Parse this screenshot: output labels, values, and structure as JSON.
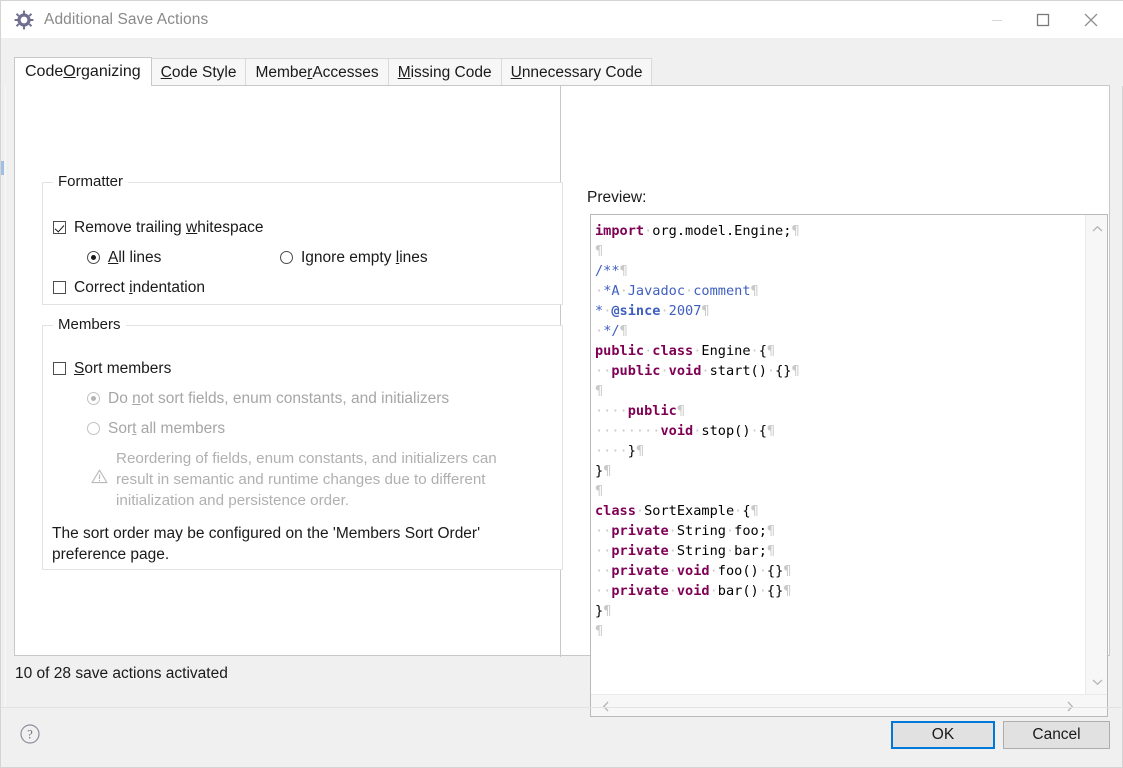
{
  "window": {
    "title": "Additional Save Actions",
    "icon": "gear-icon",
    "minimize_label": "Minimize",
    "maximize_label": "Maximize",
    "close_label": "Close"
  },
  "tabs": [
    {
      "label": "Code Organizing",
      "mnemonic": "O",
      "active": true
    },
    {
      "label": "Code Style",
      "mnemonic": "C",
      "active": false
    },
    {
      "label": "Member Accesses",
      "mnemonic": "r",
      "active": false
    },
    {
      "label": "Missing Code",
      "mnemonic": "M",
      "active": false
    },
    {
      "label": "Unnecessary Code",
      "mnemonic": "U",
      "active": false
    }
  ],
  "formatter": {
    "legend": "Formatter",
    "remove_trailing_whitespace": {
      "label_pre": "Remove trailing ",
      "label_mnemonic": "w",
      "label_post": "hitespace",
      "checked": true
    },
    "all_lines": {
      "label_pre": "",
      "label_mnemonic": "A",
      "label_post": "ll lines",
      "selected": true
    },
    "ignore_empty_lines": {
      "label_pre": "Ignore empty ",
      "label_mnemonic": "l",
      "label_post": "ines",
      "selected": false
    },
    "correct_indentation": {
      "label_pre": "Correct ",
      "label_mnemonic": "i",
      "label_post": "ndentation",
      "checked": false
    }
  },
  "members": {
    "legend": "Members",
    "sort_members": {
      "label_pre": "",
      "label_mnemonic": "S",
      "label_post": "ort members",
      "checked": false
    },
    "do_not_sort": {
      "label_pre": "Do ",
      "label_mnemonic": "n",
      "label_post": "ot sort fields, enum constants, and initializers",
      "selected": true,
      "disabled": true
    },
    "sort_all": {
      "label_pre": "Sor",
      "label_mnemonic": "t",
      "label_post": " all members",
      "selected": false,
      "disabled": true
    },
    "warning_icon": "warning-triangle-icon",
    "warning_text": "Reordering of fields, enum constants, and initializers can\nresult in semantic and runtime changes due to different\ninitialization and persistence order.",
    "sort_order_note": "The sort order may be configured on the 'Members Sort Order' preference page."
  },
  "preview": {
    "label": "Preview:",
    "scroll_up_icon": "chevron-up-icon",
    "scroll_down_icon": "chevron-down-icon",
    "scroll_left_icon": "chevron-left-icon",
    "scroll_right_icon": "chevron-right-icon",
    "colors": {
      "keyword": "#7F0055",
      "comment": "#3F5FBF",
      "plain": "#000000",
      "whitespace_mark": "#C9C9C9"
    },
    "code_lines": [
      [
        {
          "t": "import",
          "c": "kw"
        },
        {
          "t": "·",
          "c": "ws"
        },
        {
          "t": "org.model.Engine;",
          "c": "pln"
        },
        {
          "t": "¶",
          "c": "ws"
        }
      ],
      [
        {
          "t": "¶",
          "c": "ws"
        }
      ],
      [
        {
          "t": "/**",
          "c": "cmt"
        },
        {
          "t": "¶",
          "c": "ws"
        }
      ],
      [
        {
          "t": "·",
          "c": "ws"
        },
        {
          "t": "*A",
          "c": "cmt"
        },
        {
          "t": "·",
          "c": "ws"
        },
        {
          "t": "Javadoc",
          "c": "cmt"
        },
        {
          "t": "·",
          "c": "ws"
        },
        {
          "t": "comment",
          "c": "cmt"
        },
        {
          "t": "¶",
          "c": "ws"
        }
      ],
      [
        {
          "t": "*",
          "c": "cmt"
        },
        {
          "t": "·",
          "c": "ws"
        },
        {
          "t": "@since",
          "c": "cmt-b"
        },
        {
          "t": "·",
          "c": "ws"
        },
        {
          "t": "2007",
          "c": "cmt"
        },
        {
          "t": "¶",
          "c": "ws"
        }
      ],
      [
        {
          "t": "·",
          "c": "ws"
        },
        {
          "t": "*/",
          "c": "cmt"
        },
        {
          "t": "¶",
          "c": "ws"
        }
      ],
      [
        {
          "t": "public",
          "c": "kw"
        },
        {
          "t": "·",
          "c": "ws"
        },
        {
          "t": "class",
          "c": "kw"
        },
        {
          "t": "·",
          "c": "ws"
        },
        {
          "t": "Engine",
          "c": "pln"
        },
        {
          "t": "·",
          "c": "ws"
        },
        {
          "t": "{",
          "c": "pln"
        },
        {
          "t": "¶",
          "c": "ws"
        }
      ],
      [
        {
          "t": "··",
          "c": "ws"
        },
        {
          "t": "public",
          "c": "kw"
        },
        {
          "t": "·",
          "c": "ws"
        },
        {
          "t": "void",
          "c": "kw"
        },
        {
          "t": "·",
          "c": "ws"
        },
        {
          "t": "start()",
          "c": "pln"
        },
        {
          "t": "·",
          "c": "ws"
        },
        {
          "t": "{}",
          "c": "pln"
        },
        {
          "t": "¶",
          "c": "ws"
        }
      ],
      [
        {
          "t": "¶",
          "c": "ws"
        }
      ],
      [
        {
          "t": "····",
          "c": "ws"
        },
        {
          "t": "public",
          "c": "kw"
        },
        {
          "t": "¶",
          "c": "ws"
        }
      ],
      [
        {
          "t": "········",
          "c": "ws"
        },
        {
          "t": "void",
          "c": "kw"
        },
        {
          "t": "·",
          "c": "ws"
        },
        {
          "t": "stop()",
          "c": "pln"
        },
        {
          "t": "·",
          "c": "ws"
        },
        {
          "t": "{",
          "c": "pln"
        },
        {
          "t": "¶",
          "c": "ws"
        }
      ],
      [
        {
          "t": "····",
          "c": "ws"
        },
        {
          "t": "}",
          "c": "pln"
        },
        {
          "t": "¶",
          "c": "ws"
        }
      ],
      [
        {
          "t": "}",
          "c": "pln"
        },
        {
          "t": "¶",
          "c": "ws"
        }
      ],
      [
        {
          "t": "¶",
          "c": "ws"
        }
      ],
      [
        {
          "t": "class",
          "c": "kw"
        },
        {
          "t": "·",
          "c": "ws"
        },
        {
          "t": "SortExample",
          "c": "pln"
        },
        {
          "t": "·",
          "c": "ws"
        },
        {
          "t": "{",
          "c": "pln"
        },
        {
          "t": "¶",
          "c": "ws"
        }
      ],
      [
        {
          "t": "··",
          "c": "ws"
        },
        {
          "t": "private",
          "c": "kw"
        },
        {
          "t": "·",
          "c": "ws"
        },
        {
          "t": "String",
          "c": "pln"
        },
        {
          "t": "·",
          "c": "ws"
        },
        {
          "t": "foo;",
          "c": "pln"
        },
        {
          "t": "¶",
          "c": "ws"
        }
      ],
      [
        {
          "t": "··",
          "c": "ws"
        },
        {
          "t": "private",
          "c": "kw"
        },
        {
          "t": "·",
          "c": "ws"
        },
        {
          "t": "String",
          "c": "pln"
        },
        {
          "t": "·",
          "c": "ws"
        },
        {
          "t": "bar;",
          "c": "pln"
        },
        {
          "t": "¶",
          "c": "ws"
        }
      ],
      [
        {
          "t": "··",
          "c": "ws"
        },
        {
          "t": "private",
          "c": "kw"
        },
        {
          "t": "·",
          "c": "ws"
        },
        {
          "t": "void",
          "c": "kw"
        },
        {
          "t": "·",
          "c": "ws"
        },
        {
          "t": "foo()",
          "c": "pln"
        },
        {
          "t": "·",
          "c": "ws"
        },
        {
          "t": "{}",
          "c": "pln"
        },
        {
          "t": "¶",
          "c": "ws"
        }
      ],
      [
        {
          "t": "··",
          "c": "ws"
        },
        {
          "t": "private",
          "c": "kw"
        },
        {
          "t": "·",
          "c": "ws"
        },
        {
          "t": "void",
          "c": "kw"
        },
        {
          "t": "·",
          "c": "ws"
        },
        {
          "t": "bar()",
          "c": "pln"
        },
        {
          "t": "·",
          "c": "ws"
        },
        {
          "t": "{}",
          "c": "pln"
        },
        {
          "t": "¶",
          "c": "ws"
        }
      ],
      [
        {
          "t": "}",
          "c": "pln"
        },
        {
          "t": "¶",
          "c": "ws"
        }
      ],
      [
        {
          "t": "¶",
          "c": "ws"
        }
      ]
    ]
  },
  "status": {
    "text": "10 of 28 save actions activated"
  },
  "footer": {
    "help_icon": "help-question-icon",
    "ok_label": "OK",
    "cancel_label": "Cancel",
    "focus_color": "#0078D7"
  }
}
